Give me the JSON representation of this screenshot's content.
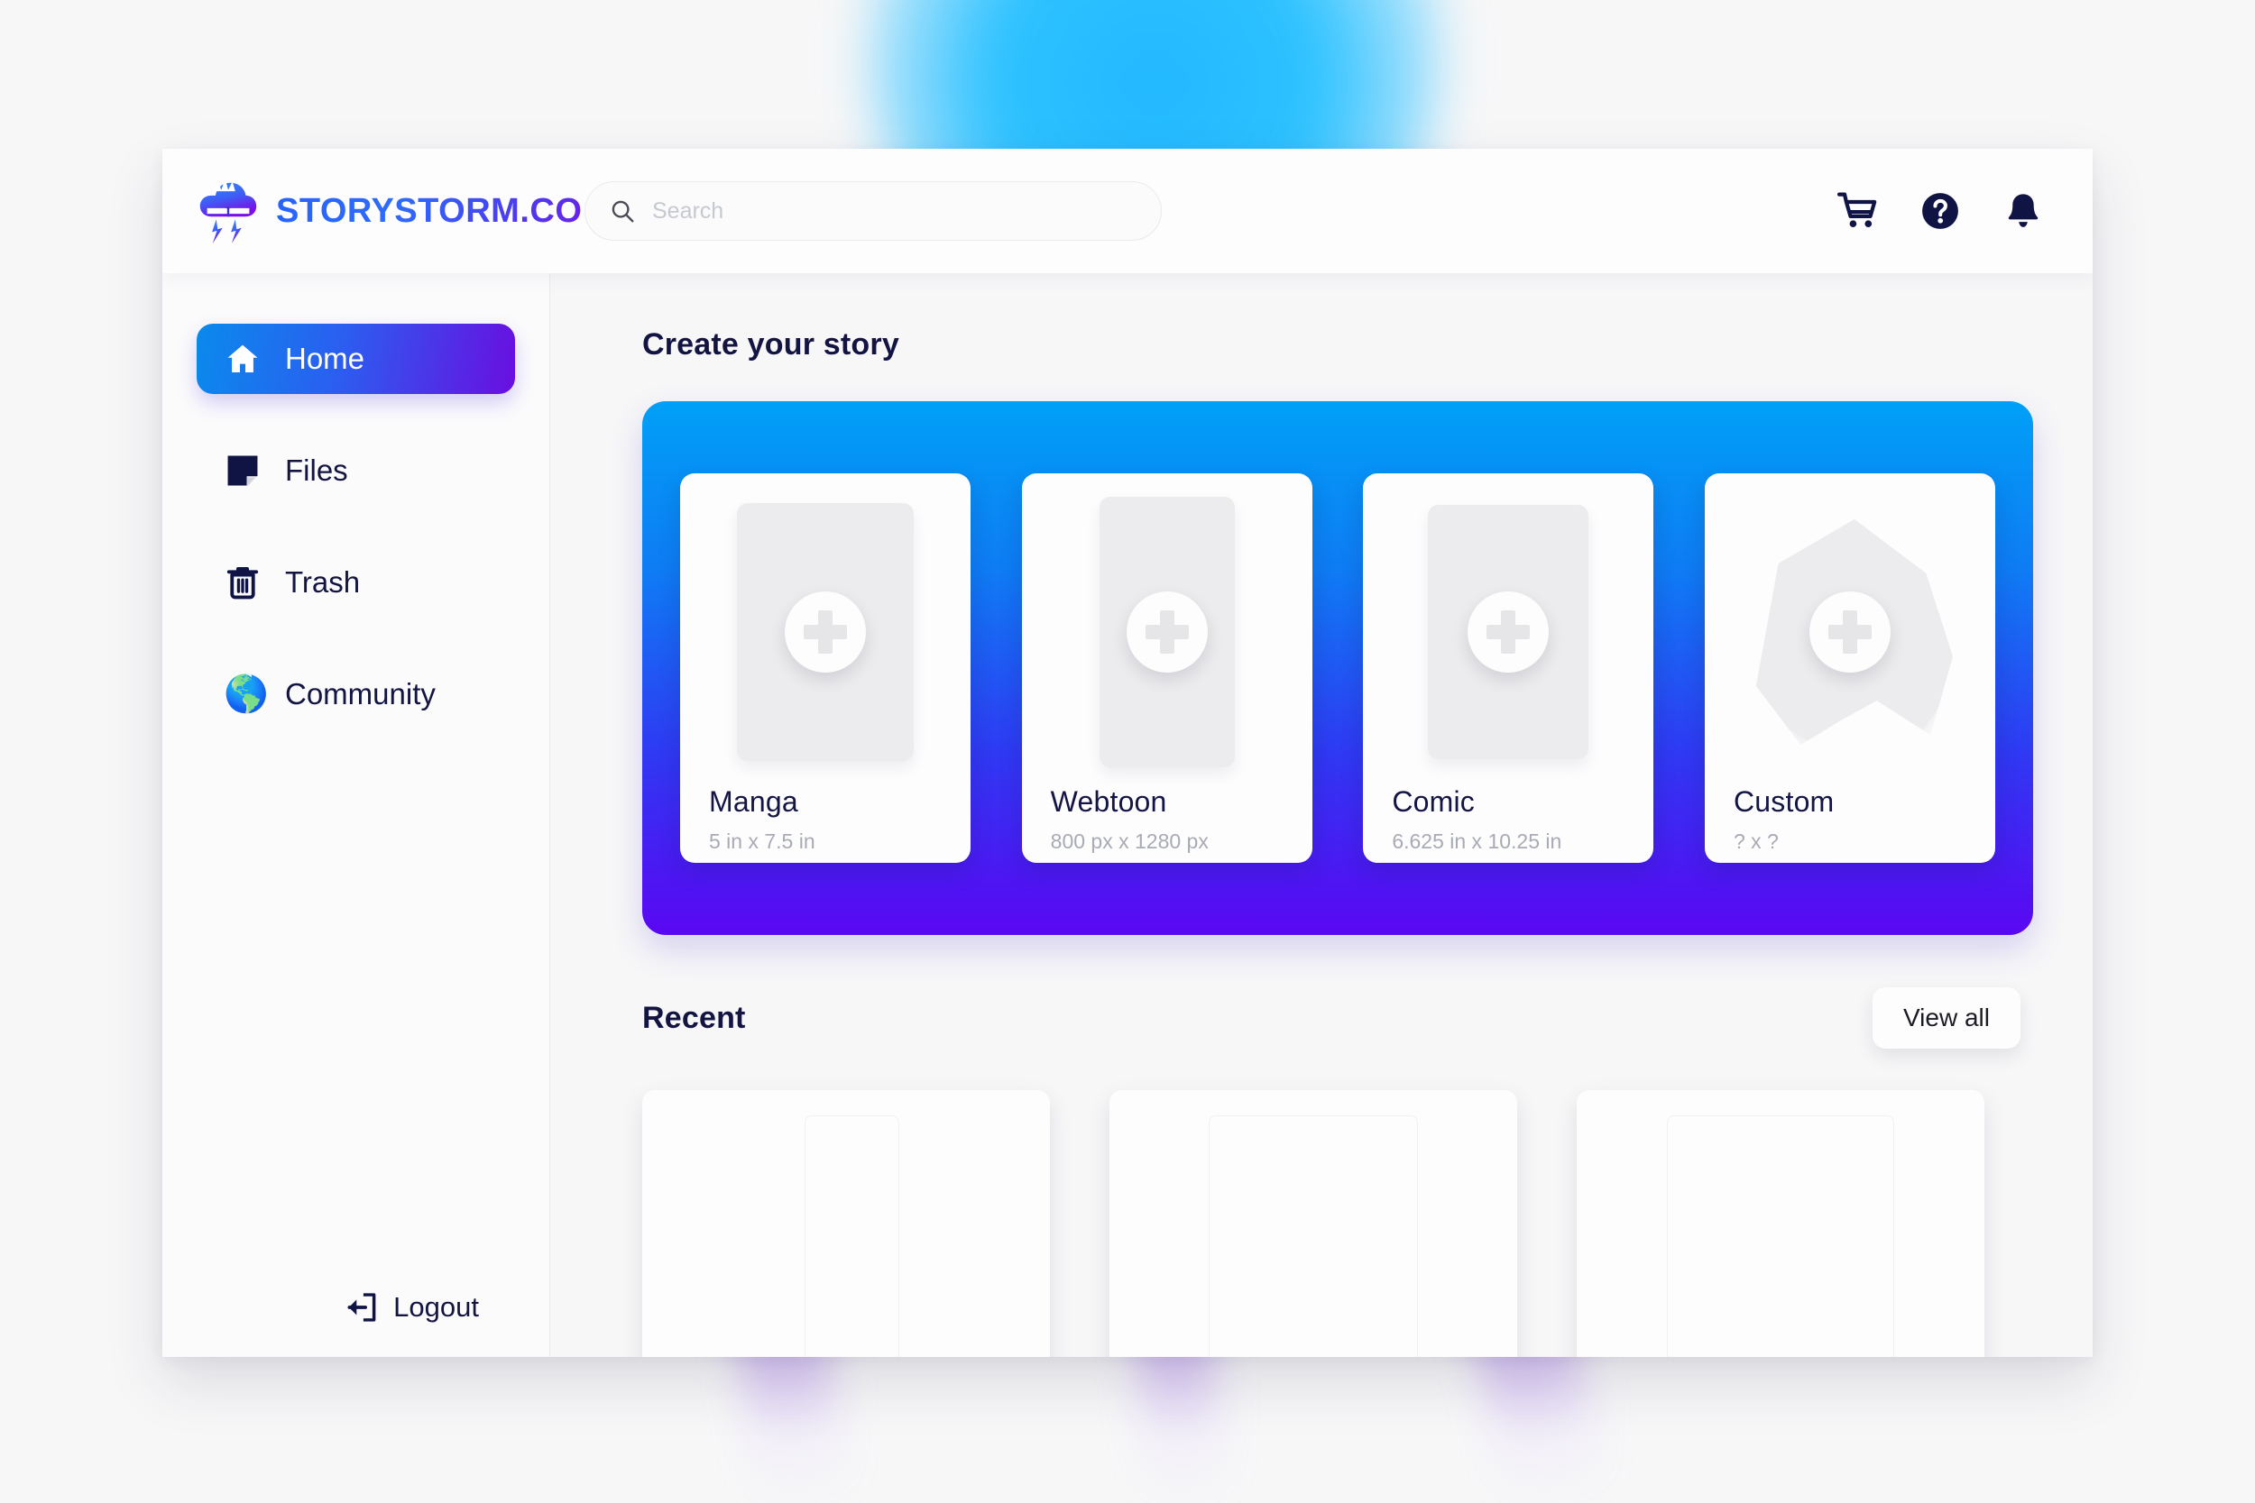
{
  "brand": {
    "name": "STORYSTORM.CO",
    "logo_icon": "storm-cloud-book-logo"
  },
  "search": {
    "placeholder": "Search",
    "value": "",
    "icon": "search-icon"
  },
  "top_actions": [
    {
      "name": "cart",
      "icon": "shopping-cart-icon"
    },
    {
      "name": "help",
      "icon": "question-circle-icon"
    },
    {
      "name": "notifications",
      "icon": "bell-icon"
    }
  ],
  "sidebar": {
    "items": [
      {
        "label": "Home",
        "icon": "home-icon",
        "active": true
      },
      {
        "label": "Files",
        "icon": "file-note-icon",
        "active": false
      },
      {
        "label": "Trash",
        "icon": "trash-icon",
        "active": false
      },
      {
        "label": "Community",
        "icon": "globe-icon",
        "active": false
      }
    ],
    "logout": {
      "label": "Logout",
      "icon": "logout-arrow-icon"
    }
  },
  "main": {
    "create_section": {
      "title": "Create your story",
      "cards": [
        {
          "title": "Manga",
          "size": "5 in x 7.5 in",
          "shape": "portrait-rect",
          "add_icon": "plus-icon"
        },
        {
          "title": "Webtoon",
          "size": "800 px x 1280 px",
          "shape": "tall-rect",
          "add_icon": "plus-icon"
        },
        {
          "title": "Comic",
          "size": "6.625 in x 10.25 in",
          "shape": "portrait-rect",
          "add_icon": "plus-icon"
        },
        {
          "title": "Custom",
          "size": "? x ?",
          "shape": "blob",
          "add_icon": "plus-icon"
        }
      ]
    },
    "recent_section": {
      "title": "Recent",
      "view_all_label": "View all",
      "cards": [
        {
          "name": "recent-card-1"
        },
        {
          "name": "recent-card-2"
        },
        {
          "name": "recent-card-3"
        }
      ]
    }
  },
  "colors": {
    "accent_blue": "#00a0f7",
    "accent_purple": "#5a07f2",
    "text_navy": "#131442",
    "muted_gray": "#a9abb4",
    "panel_bg": "#f7f7f8"
  }
}
